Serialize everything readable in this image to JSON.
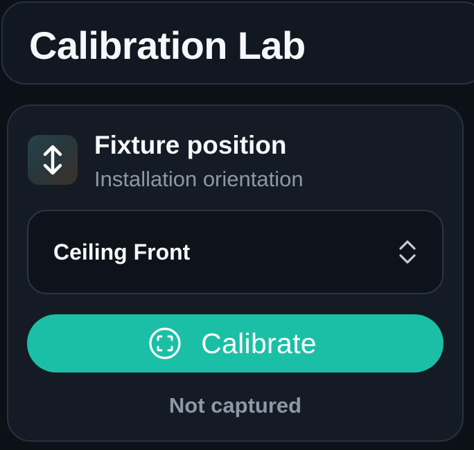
{
  "header": {
    "title": "Calibration Lab"
  },
  "card": {
    "icon": "vertical-arrows-icon",
    "title": "Fixture position",
    "subtitle": "Installation orientation",
    "select": {
      "value": "Ceiling Front",
      "icon": "chevron-up-down-icon"
    },
    "button": {
      "label": "Calibrate",
      "icon": "focus-target-icon"
    },
    "status": "Not captured"
  },
  "colors": {
    "background": "#0c1118",
    "card": "#141b25",
    "border": "#273241",
    "accent": "#1bbfa6",
    "muted_text": "#8e97a6"
  }
}
